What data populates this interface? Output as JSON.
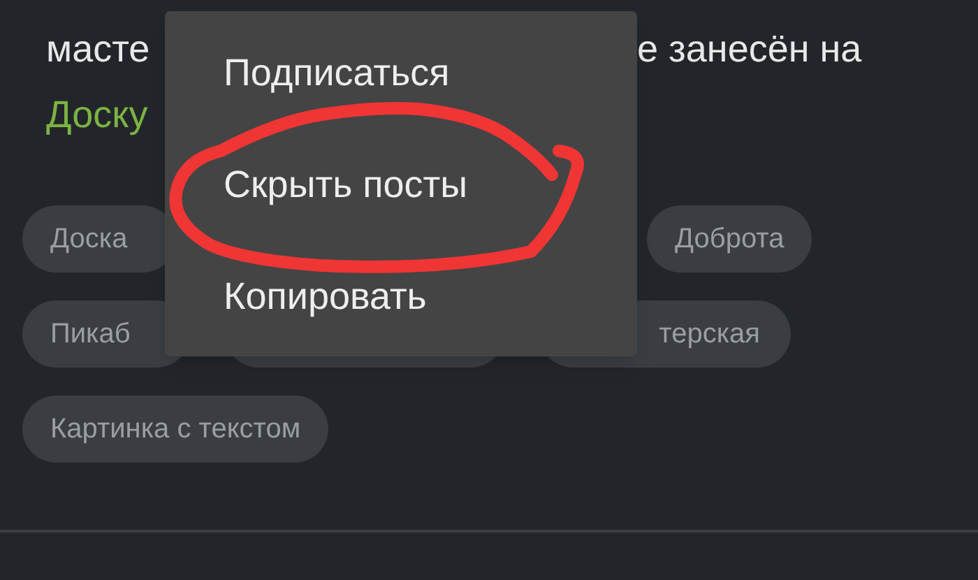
{
  "post_text": [
    {
      "text": "масте",
      "kind": "plain"
    },
    {
      "text": "е занесён на",
      "kind": "plain"
    },
    {
      "text": "Доску",
      "kind": "link"
    }
  ],
  "tag_rows": [
    [
      {
        "kind": "tag",
        "label": "Доска"
      },
      {
        "kind": "tag",
        "label": "Доброта"
      }
    ],
    [
      {
        "kind": "tag",
        "label": "Пикаб"
      },
      {
        "kind": "covered"
      },
      {
        "kind": "tag_end",
        "label": "терская"
      }
    ],
    [
      {
        "kind": "tag",
        "label": "Картинка с текстом"
      }
    ]
  ],
  "context_menu": {
    "items": [
      {
        "label": "Подписаться",
        "circled": false
      },
      {
        "label": "Скрыть посты",
        "circled": true
      },
      {
        "label": "Копировать",
        "circled": false
      }
    ]
  }
}
